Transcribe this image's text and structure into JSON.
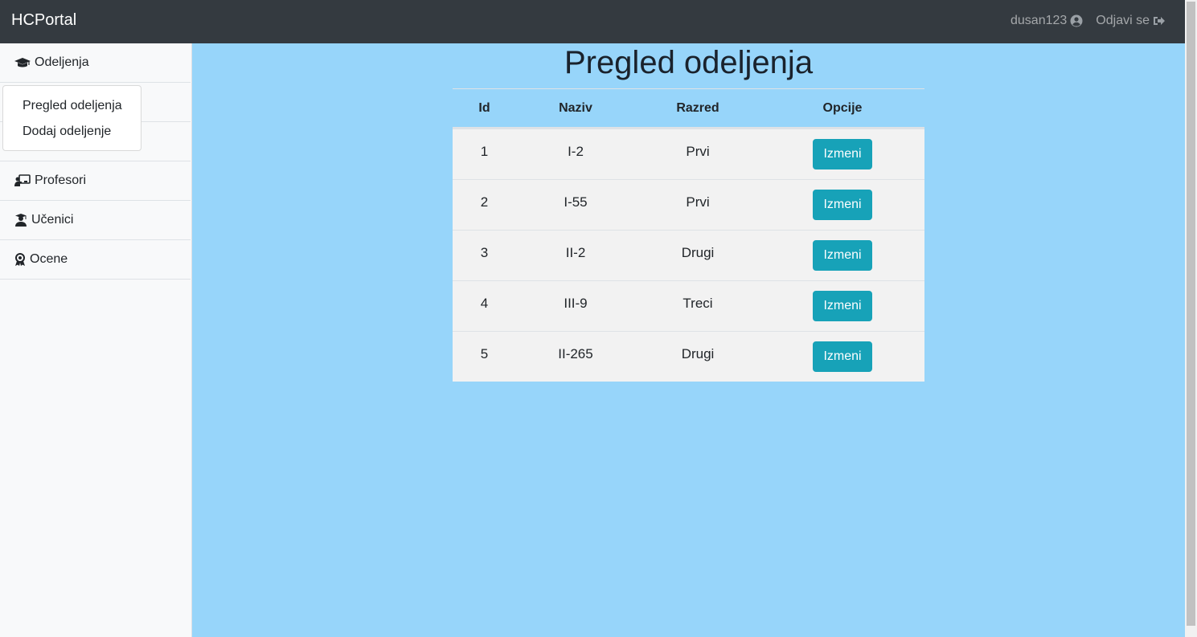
{
  "navbar": {
    "brand": "HCPortal",
    "username": "dusan123",
    "logout": "Odjavi se"
  },
  "sidebar": {
    "items": [
      {
        "label": "Odeljenja",
        "icon": "graduation-cap-icon"
      },
      {
        "label": "",
        "icon": ""
      },
      {
        "label": "",
        "icon": ""
      },
      {
        "label": "Profesori",
        "icon": "chalkboard-teacher-icon"
      },
      {
        "label": "Učenici",
        "icon": "user-graduate-icon"
      },
      {
        "label": "Ocene",
        "icon": "award-icon"
      }
    ],
    "dropdown": [
      "Pregled odeljenja",
      "Dodaj odeljenje"
    ]
  },
  "main": {
    "title": "Pregled odeljenja",
    "table": {
      "headers": [
        "Id",
        "Naziv",
        "Razred",
        "Opcije"
      ],
      "rows": [
        {
          "id": "1",
          "naziv": "I-2",
          "razred": "Prvi",
          "action": "Izmeni"
        },
        {
          "id": "2",
          "naziv": "I-55",
          "razred": "Prvi",
          "action": "Izmeni"
        },
        {
          "id": "3",
          "naziv": "II-2",
          "razred": "Drugi",
          "action": "Izmeni"
        },
        {
          "id": "4",
          "naziv": "III-9",
          "razred": "Treci",
          "action": "Izmeni"
        },
        {
          "id": "5",
          "naziv": "II-265",
          "razred": "Drugi",
          "action": "Izmeni"
        }
      ]
    }
  },
  "colors": {
    "navbar": "#343a40",
    "background": "#97d5fa",
    "button": "#17a2b8",
    "row": "#f2f2f2"
  }
}
